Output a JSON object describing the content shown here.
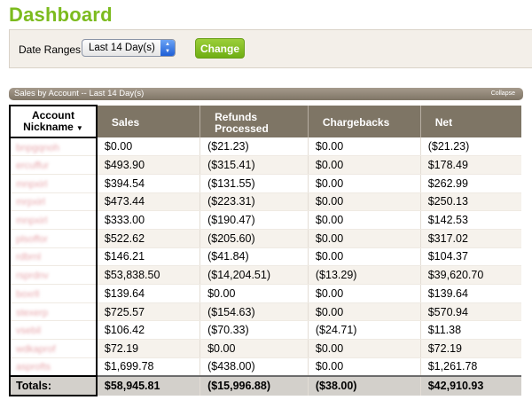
{
  "header": {
    "title": "Dashboard"
  },
  "filter": {
    "label": "Date Ranges:",
    "selected_range": "Last 14 Day(s)",
    "change_label": "Change"
  },
  "panel": {
    "title": "Sales by Account -- Last 14 Day(s)",
    "collapse_label": "Collapse"
  },
  "table": {
    "headers": {
      "nickname_line1": "Account",
      "nickname_line2": "Nickname",
      "sales": "Sales",
      "refunds_line1": "Refunds",
      "refunds_line2": "Processed",
      "chargebacks": "Chargebacks",
      "net": "Net"
    },
    "rows": [
      {
        "nickname": "bnpgqnoh",
        "sales": "$0.00",
        "refunds": "($21.23)",
        "chargebacks": "$0.00",
        "net": "($21.23)"
      },
      {
        "nickname": "ercuffur",
        "sales": "$493.90",
        "refunds": "($315.41)",
        "chargebacks": "$0.00",
        "net": "$178.49"
      },
      {
        "nickname": "mnpxirl",
        "sales": "$394.54",
        "refunds": "($131.55)",
        "chargebacks": "$0.00",
        "net": "$262.99"
      },
      {
        "nickname": "mrpxirl",
        "sales": "$473.44",
        "refunds": "($223.31)",
        "chargebacks": "$0.00",
        "net": "$250.13"
      },
      {
        "nickname": "mnpxirl",
        "sales": "$333.00",
        "refunds": "($190.47)",
        "chargebacks": "$0.00",
        "net": "$142.53"
      },
      {
        "nickname": "plsoffor",
        "sales": "$522.62",
        "refunds": "($205.60)",
        "chargebacks": "$0.00",
        "net": "$317.02"
      },
      {
        "nickname": "rdbrnl",
        "sales": "$146.21",
        "refunds": "($41.84)",
        "chargebacks": "$0.00",
        "net": "$104.37"
      },
      {
        "nickname": "rsprdnv",
        "sales": "$53,838.50",
        "refunds": "($14,204.51)",
        "chargebacks": "($13.29)",
        "net": "$39,620.70"
      },
      {
        "nickname": "boxrll",
        "sales": "$139.64",
        "refunds": "$0.00",
        "chargebacks": "$0.00",
        "net": "$139.64"
      },
      {
        "nickname": "stexerp",
        "sales": "$725.57",
        "refunds": "($154.63)",
        "chargebacks": "$0.00",
        "net": "$570.94"
      },
      {
        "nickname": "vsebil",
        "sales": "$106.42",
        "refunds": "($70.33)",
        "chargebacks": "($24.71)",
        "net": "$11.38"
      },
      {
        "nickname": "wdkaprof",
        "sales": "$72.19",
        "refunds": "$0.00",
        "chargebacks": "$0.00",
        "net": "$72.19"
      },
      {
        "nickname": "asprofts",
        "sales": "$1,699.78",
        "refunds": "($438.00)",
        "chargebacks": "$0.00",
        "net": "$1,261.78"
      }
    ],
    "totals": {
      "label": "Totals:",
      "sales": "$58,945.81",
      "refunds": "($15,996.88)",
      "chargebacks": "($38.00)",
      "net": "$42,910.93"
    }
  },
  "colors": {
    "title_green": "#7cbb1e",
    "button_green": "#82bf24",
    "header_brown": "#7e7565"
  }
}
